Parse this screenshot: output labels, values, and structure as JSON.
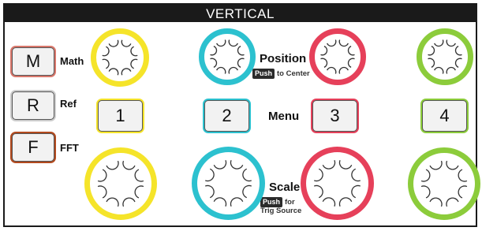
{
  "panel": {
    "title": "VERTICAL"
  },
  "side_buttons": [
    {
      "key": "M",
      "label": "Math",
      "color": "#d9776b"
    },
    {
      "key": "R",
      "label": "Ref",
      "color": "#cccccc"
    },
    {
      "key": "F",
      "label": "FFT",
      "color": "#b34a1e"
    }
  ],
  "channels": [
    {
      "number": "1",
      "color": "#f5e42a"
    },
    {
      "number": "2",
      "color": "#2cc1cf"
    },
    {
      "number": "3",
      "color": "#e6405a"
    },
    {
      "number": "4",
      "color": "#8ccc3b"
    }
  ],
  "position": {
    "label": "Position",
    "push_badge": "Push",
    "push_text": "to Center"
  },
  "menu": {
    "label": "Menu"
  },
  "scale": {
    "label": "Scale",
    "push_badge": "Push",
    "push_text_1": "for",
    "push_text_2": "Trig Source"
  },
  "icons": {
    "knob": "knob-icon"
  }
}
